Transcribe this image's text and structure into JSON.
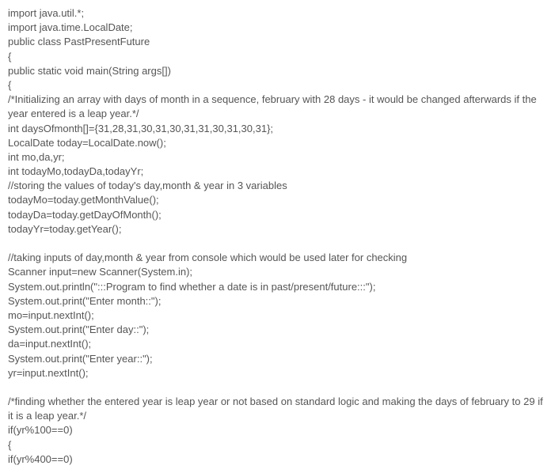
{
  "code_lines": [
    "import java.util.*;",
    "import java.time.LocalDate;",
    "public class PastPresentFuture",
    "{",
    "public static void main(String args[])",
    "{",
    "/*Initializing an array with days of month in a sequence, february with 28 days - it would be changed afterwards if the year entered is a leap year.*/",
    "int daysOfmonth[]={31,28,31,30,31,30,31,31,30,31,30,31};",
    "LocalDate today=LocalDate.now();",
    "int mo,da,yr;",
    "int todayMo,todayDa,todayYr;",
    "//storing the values of today's day,month & year in 3 variables",
    "todayMo=today.getMonthValue();",
    "todayDa=today.getDayOfMonth();",
    "todayYr=today.getYear();",
    "",
    "//taking inputs of day,month & year from console which would be used later for checking",
    "Scanner input=new Scanner(System.in);",
    "System.out.println(\":::Program to find whether a date is in past/present/future:::\");",
    "System.out.print(\"Enter month::\");",
    "mo=input.nextInt();",
    "System.out.print(\"Enter day::\");",
    "da=input.nextInt();",
    "System.out.print(\"Enter year::\");",
    "yr=input.nextInt();",
    "",
    "/*finding whether the entered year is leap year or not based on standard logic and making the days of february to 29 if it is a leap year.*/",
    "if(yr%100==0)",
    "{",
    "if(yr%400==0)"
  ]
}
